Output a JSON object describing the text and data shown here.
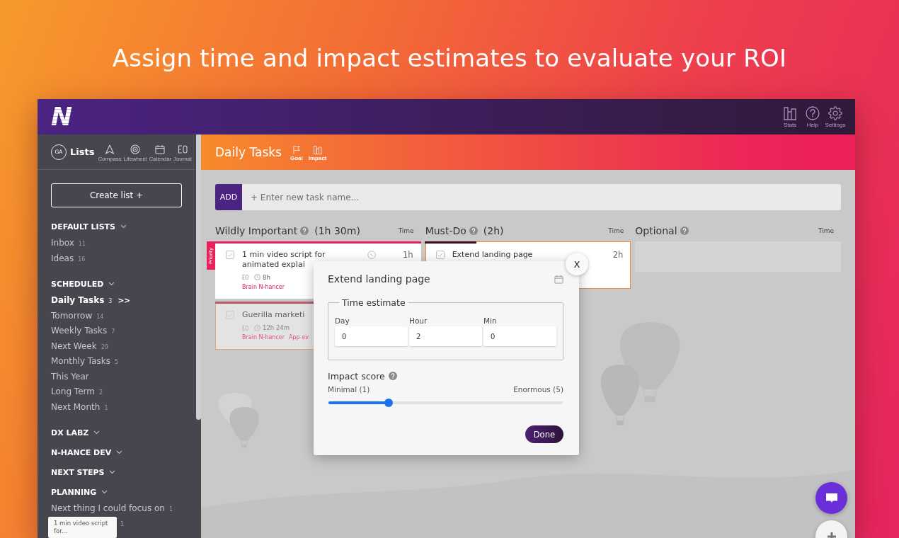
{
  "headline": "Assign time and impact estimates to evaluate your ROI",
  "topbar": {
    "logo": "N",
    "actions": [
      {
        "kind": "stats",
        "label": "Stats"
      },
      {
        "kind": "help",
        "label": "Help"
      },
      {
        "kind": "settings",
        "label": "Settings"
      }
    ]
  },
  "sidebar": {
    "avatar": "GA",
    "title": "Lists",
    "nav": [
      {
        "kind": "compass",
        "label": "Compass"
      },
      {
        "kind": "lifewheel",
        "label": "Lifewheel"
      },
      {
        "kind": "calendar",
        "label": "Calendar"
      },
      {
        "kind": "journal",
        "label": "Journal"
      }
    ],
    "create_button": "Create list +",
    "sections": [
      {
        "title": "DEFAULT LISTS",
        "items": [
          {
            "name": "Inbox",
            "count": "11",
            "selected": false
          },
          {
            "name": "Ideas",
            "count": "16",
            "selected": false
          }
        ]
      },
      {
        "title": "SCHEDULED",
        "items": [
          {
            "name": "Daily Tasks",
            "count": "3",
            "suffix": ">>",
            "selected": true
          },
          {
            "name": "Tomorrow",
            "count": "14",
            "selected": false
          },
          {
            "name": "Weekly Tasks",
            "count": "7",
            "selected": false
          },
          {
            "name": "Next Week",
            "count": "29",
            "selected": false
          },
          {
            "name": "Monthly Tasks",
            "count": "5",
            "selected": false
          },
          {
            "name": "This Year",
            "selected": false
          },
          {
            "name": "Long Term",
            "count": "2",
            "selected": false
          },
          {
            "name": "Next Month",
            "count": "1",
            "selected": false
          }
        ]
      },
      {
        "title": "DX LABZ"
      },
      {
        "title": "N-HANCE DEV"
      },
      {
        "title": "NEXT STEPS"
      },
      {
        "title": "PLANNING",
        "items": [
          {
            "name": "Next thing I could focus on",
            "count": "1",
            "selected": false
          },
          {
            "count": "1",
            "selected": false
          }
        ]
      }
    ],
    "drag_preview": "1 min video script for..."
  },
  "main": {
    "title": "Daily Tasks",
    "actions": [
      {
        "kind": "goal",
        "label": "Goal"
      },
      {
        "kind": "impact",
        "label": "Impact"
      }
    ],
    "add_button": "ADD",
    "task_input": {
      "placeholder": "+ Enter new task name..."
    },
    "columns": [
      {
        "title": "Wildly Important",
        "total": "(1h 30m)",
        "time_label": "Time",
        "cards": [
          {
            "title": "1 min video script for animated explai",
            "time": "1h",
            "priority": "Priority",
            "indicator": true,
            "duration": "8h",
            "tags": [
              "Brain N-hancer"
            ],
            "level": 1,
            "color": "#e8215a",
            "selected": false,
            "dimmed": false
          },
          {
            "title": "Guerilla marketi",
            "indicator": false,
            "duration": "12h 24m",
            "tags": [
              "Brain N-hancer",
              "App ev"
            ],
            "level": 1,
            "color": "#b85a6c",
            "selected": true,
            "dimmed": true
          }
        ]
      },
      {
        "title": "Must-Do",
        "total": "(2h)",
        "time_label": "Time",
        "cards": [
          {
            "title": "Extend landing page",
            "time": "2h",
            "indicator": false,
            "level": 0.25,
            "color": "#3a0a12",
            "selected": true,
            "dimmed": false
          }
        ]
      },
      {
        "title": "Optional",
        "time_label": "Time"
      }
    ]
  },
  "dialog": {
    "title": "Extend landing page",
    "close": "X",
    "legend": "Time estimate",
    "fields": [
      {
        "label": "Day",
        "value": "0"
      },
      {
        "label": "Hour",
        "value": "2"
      },
      {
        "label": "Min",
        "value": "0"
      }
    ],
    "impact": {
      "label": "Impact score",
      "min_label": "Minimal (1)",
      "max_label": "Enormous (5)",
      "level": 0.25
    },
    "done": "Done"
  }
}
